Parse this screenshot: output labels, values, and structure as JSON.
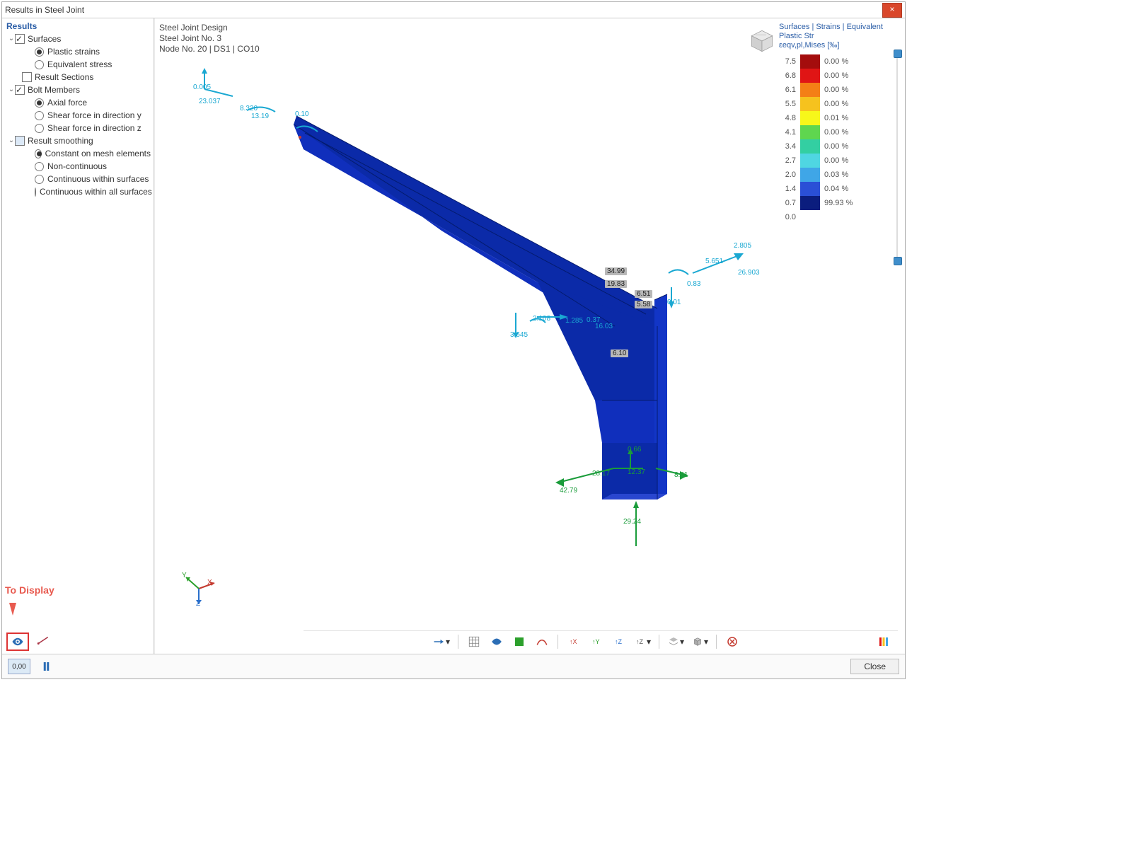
{
  "window": {
    "title": "Results in Steel Joint"
  },
  "side": {
    "heading": "Results",
    "surfaces": {
      "label": "Surfaces",
      "plastic": "Plastic strains",
      "equiv": "Equivalent stress"
    },
    "result_sections": "Result Sections",
    "bolt_members": {
      "label": "Bolt Members",
      "axial": "Axial force",
      "shear_y": "Shear force in direction y",
      "shear_z": "Shear force in direction z"
    },
    "smoothing": {
      "label": "Result smoothing",
      "constant": "Constant on mesh elements",
      "noncont": "Non-continuous",
      "cont_surf": "Continuous within surfaces",
      "cont_all": "Continuous within all surfaces"
    },
    "to_display": "To Display"
  },
  "viewer": {
    "line1": "Steel Joint Design",
    "line2": "Steel Joint No. 3",
    "line3": "Node No. 20 | DS1 | CO10",
    "labels": {
      "u_top_left": [
        "0.005",
        "23.037",
        "8.320",
        "13.19",
        "0.10"
      ],
      "u_mid": [
        "3.645",
        "2.108",
        "1.285",
        "0.37",
        "16.03"
      ],
      "u_right": [
        "2.805",
        "5.651",
        "26.903",
        "0.83",
        "0.01"
      ],
      "boxes": [
        "34.99",
        "19.83",
        "6.51",
        "5.58",
        "6.10"
      ]
    },
    "support": {
      "top": "0.66",
      "mid": "28.17",
      "mid2": "12.37",
      "left": "42.79",
      "right": "8.41",
      "down": "29.24"
    }
  },
  "legend": {
    "title1": "Surfaces | Strains | Equivalent Plastic Str",
    "title2": "εeqv,pl,Mises [‰]",
    "rows": [
      {
        "tick": "7.5",
        "color": "#a40d0d",
        "pct": "0.00 %"
      },
      {
        "tick": "6.8",
        "color": "#e01515",
        "pct": "0.00 %"
      },
      {
        "tick": "6.1",
        "color": "#f47f16",
        "pct": "0.00 %"
      },
      {
        "tick": "5.5",
        "color": "#f6c21e",
        "pct": "0.00 %"
      },
      {
        "tick": "4.8",
        "color": "#f7f71a",
        "pct": "0.01 %"
      },
      {
        "tick": "4.1",
        "color": "#5fd64f",
        "pct": "0.00 %"
      },
      {
        "tick": "3.4",
        "color": "#33cfa2",
        "pct": "0.00 %"
      },
      {
        "tick": "2.7",
        "color": "#4fd6e2",
        "pct": "0.00 %"
      },
      {
        "tick": "2.0",
        "color": "#3fa6e7",
        "pct": "0.03 %"
      },
      {
        "tick": "1.4",
        "color": "#2a4fd6",
        "pct": "0.04 %"
      },
      {
        "tick": "0.7",
        "color": "#0b1d7e",
        "pct": "99.93 %"
      },
      {
        "tick": "0.0",
        "color": "",
        "pct": ""
      }
    ]
  },
  "axes": {
    "x": "X",
    "y": "Y",
    "z": "Z"
  },
  "footer": {
    "close": "Close"
  }
}
